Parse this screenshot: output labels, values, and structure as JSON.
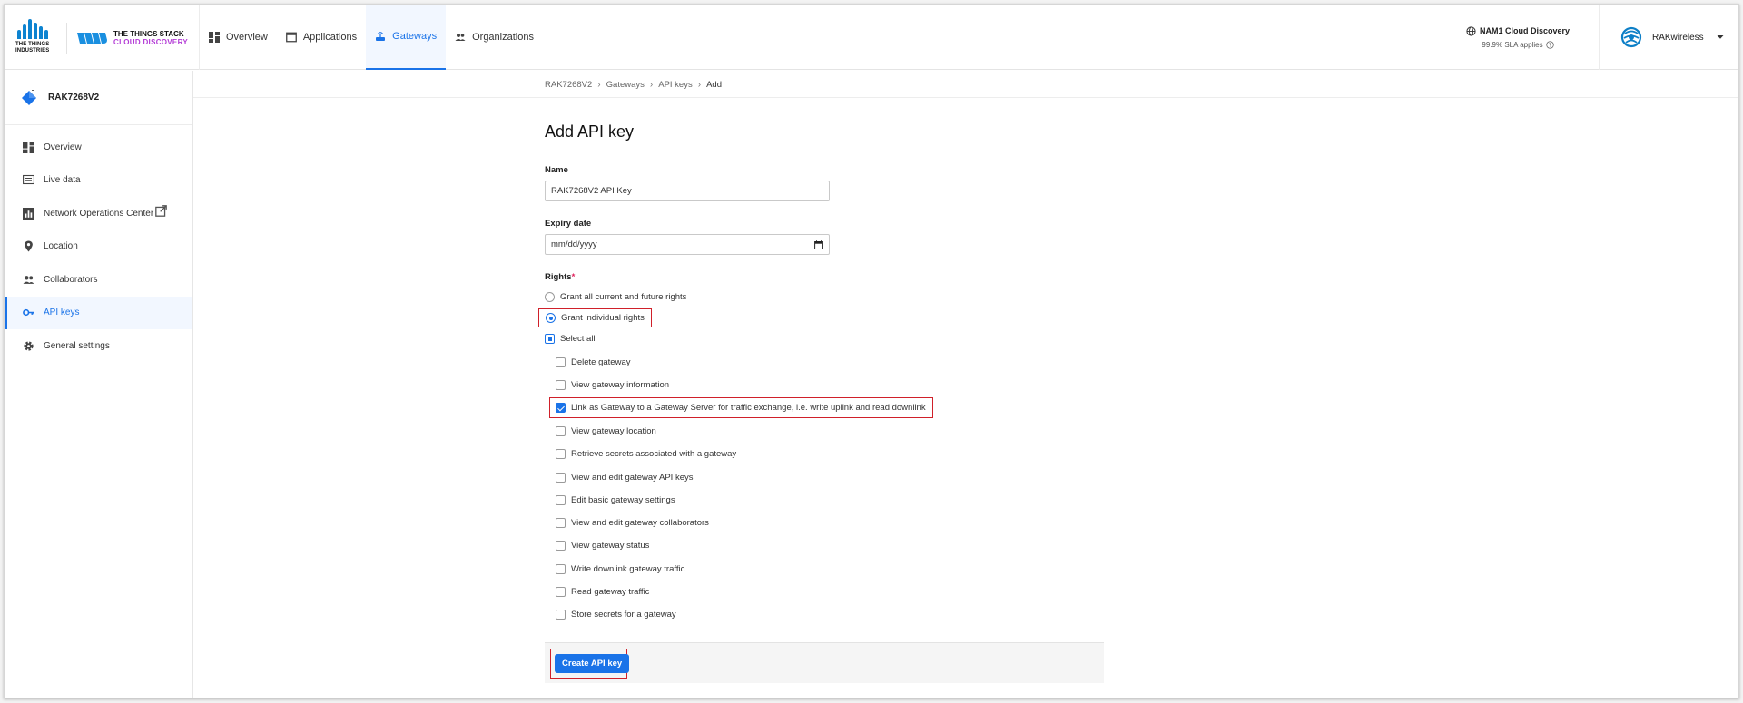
{
  "header": {
    "tti_logo_text": "THE THINGS INDUSTRIES",
    "tts_line1": "THE THINGS STACK",
    "tts_line2": "CLOUD DISCOVERY",
    "nav": [
      {
        "label": "Overview",
        "icon": "dashboard-icon"
      },
      {
        "label": "Applications",
        "icon": "window-icon"
      },
      {
        "label": "Gateways",
        "icon": "gateway-icon",
        "active": true
      },
      {
        "label": "Organizations",
        "icon": "people-icon"
      }
    ],
    "cluster_name": "NAM1 Cloud Discovery",
    "sla_text": "99.9% SLA applies",
    "user_name": "RAKwireless"
  },
  "sidebar": {
    "gateway_name": "RAK7268V2",
    "items": [
      {
        "label": "Overview",
        "icon": "dashboard-icon"
      },
      {
        "label": "Live data",
        "icon": "list-icon"
      },
      {
        "label": "Network Operations Center",
        "icon": "chart-icon",
        "external": true
      },
      {
        "label": "Location",
        "icon": "pin-icon"
      },
      {
        "label": "Collaborators",
        "icon": "people-icon"
      },
      {
        "label": "API keys",
        "icon": "key-icon",
        "active": true
      },
      {
        "label": "General settings",
        "icon": "gear-icon"
      }
    ]
  },
  "breadcrumb": [
    "RAK7268V2",
    "Gateways",
    "API keys",
    "Add"
  ],
  "form": {
    "title": "Add API key",
    "name_label": "Name",
    "name_value": "RAK7268V2 API Key",
    "expiry_label": "Expiry date",
    "expiry_placeholder": "mm/dd/yyyy",
    "rights_label": "Rights",
    "rights_required_mark": "*",
    "grant_all_label": "Grant all current and future rights",
    "grant_individual_label": "Grant individual rights",
    "select_all_label": "Select all",
    "rights": [
      {
        "label": "Delete gateway",
        "checked": false
      },
      {
        "label": "View gateway information",
        "checked": false
      },
      {
        "label": "Link as Gateway to a Gateway Server for traffic exchange, i.e. write uplink and read downlink",
        "checked": true
      },
      {
        "label": "View gateway location",
        "checked": false
      },
      {
        "label": "Retrieve secrets associated with a gateway",
        "checked": false
      },
      {
        "label": "View and edit gateway API keys",
        "checked": false
      },
      {
        "label": "Edit basic gateway settings",
        "checked": false
      },
      {
        "label": "View and edit gateway collaborators",
        "checked": false
      },
      {
        "label": "View gateway status",
        "checked": false
      },
      {
        "label": "Write downlink gateway traffic",
        "checked": false
      },
      {
        "label": "Read gateway traffic",
        "checked": false
      },
      {
        "label": "Store secrets for a gateway",
        "checked": false
      }
    ],
    "submit_label": "Create API key"
  },
  "colors": {
    "accent": "#1a73e8",
    "highlight": "#d0202a",
    "brand_purple": "#b33bd6",
    "brand_blue": "#0d83d0"
  }
}
